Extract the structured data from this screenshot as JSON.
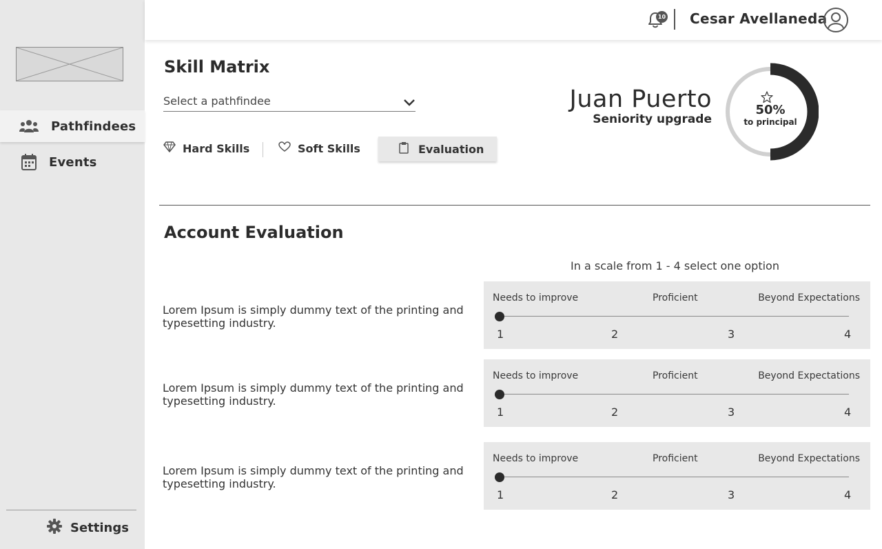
{
  "sidebar": {
    "items": [
      {
        "label": "Pathfindees",
        "icon": "users-icon",
        "active": true
      },
      {
        "label": "Events",
        "icon": "calendar-icon",
        "active": false
      }
    ],
    "settings_label": "Settings"
  },
  "topbar": {
    "notification_count": "10",
    "user_name": "Cesar Avellaneda"
  },
  "main": {
    "title": "Skill Matrix",
    "select": {
      "value": "Select a pathfindee"
    },
    "tabs": [
      {
        "label": "Hard Skills",
        "icon": "diamond-icon"
      },
      {
        "label": "Soft Skills",
        "icon": "heart-icon"
      },
      {
        "label": "Evaluation",
        "icon": "clipboard-icon",
        "active": true
      }
    ],
    "person": {
      "name": "Juan Puerto",
      "subtitle": "Seniority upgrade",
      "progress": 0.5,
      "progress_label": "50%",
      "progress_sub": "to principal"
    }
  },
  "evaluation": {
    "title": "Account Evaluation",
    "scale_note": "In a scale from 1 - 4 select one option",
    "labels": [
      "Needs to improve",
      "Proficient",
      "Beyond Expectations"
    ],
    "numbers": [
      "1",
      "2",
      "3",
      "4"
    ],
    "questions": [
      {
        "text": "Lorem Ipsum is simply dummy text of the printing and typesetting industry.",
        "value": 1
      },
      {
        "text": "Lorem Ipsum is simply dummy text of the printing and typesetting industry.",
        "value": 1
      },
      {
        "text": "Lorem Ipsum is simply dummy text of the printing and typesetting industry.",
        "value": 1
      }
    ]
  },
  "colors": {
    "sidebar_bg": "#e8e8e8",
    "accent_dark": "#2b2b2b",
    "ring_track": "#d0d0d0"
  }
}
